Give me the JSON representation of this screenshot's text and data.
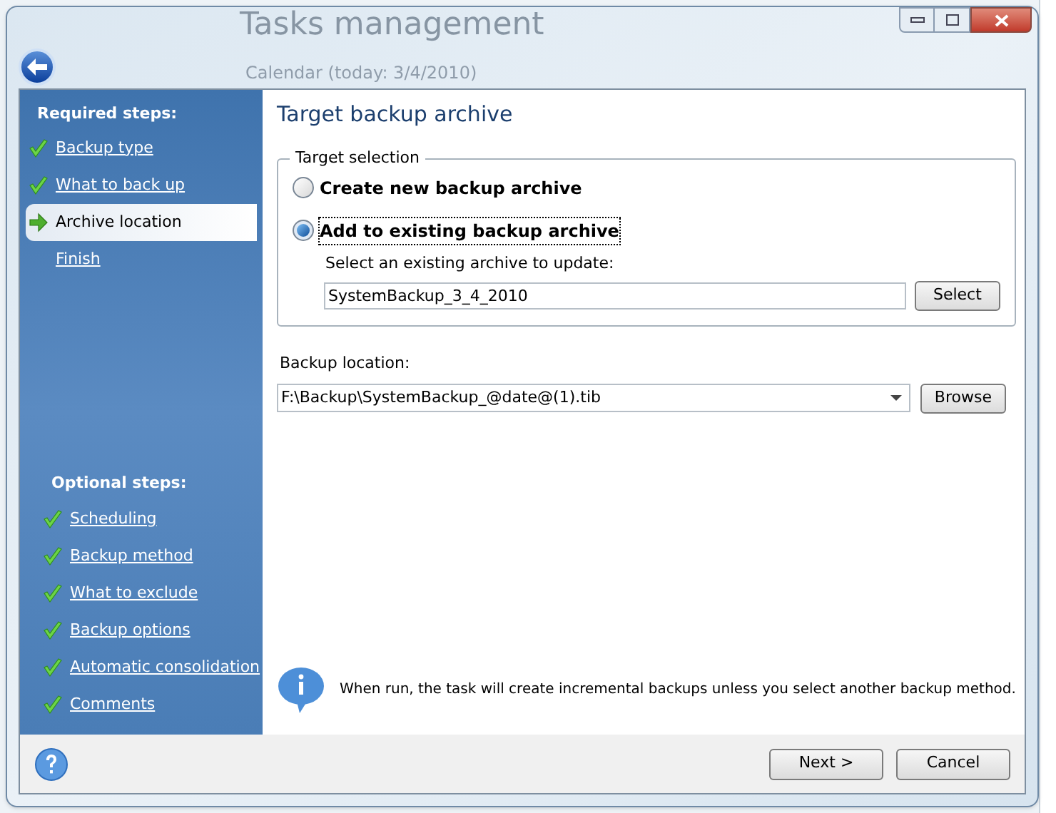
{
  "background_window": {
    "title": "Tasks management",
    "subtitle": "Calendar (today: 3/4/2010)"
  },
  "sidebar": {
    "required_heading": "Required steps:",
    "required_steps": [
      {
        "label": "Backup type",
        "completed": true,
        "selected": false
      },
      {
        "label": "What to back up",
        "completed": true,
        "selected": false
      },
      {
        "label": "Archive location",
        "completed": false,
        "selected": true
      },
      {
        "label": "Finish",
        "completed": false,
        "selected": false
      }
    ],
    "optional_heading": "Optional steps:",
    "optional_steps": [
      {
        "label": "Scheduling",
        "completed": true,
        "selected": false
      },
      {
        "label": "Backup method",
        "completed": true,
        "selected": false
      },
      {
        "label": "What to exclude",
        "completed": true,
        "selected": false
      },
      {
        "label": "Backup options",
        "completed": true,
        "selected": false
      },
      {
        "label": "Automatic consolidation",
        "completed": true,
        "selected": false
      },
      {
        "label": "Comments",
        "completed": true,
        "selected": false
      }
    ]
  },
  "page_title": "Target backup archive",
  "target_selection": {
    "legend": "Target selection",
    "options": [
      {
        "label": "Create new backup archive",
        "selected": false
      },
      {
        "label": "Add to existing backup archive",
        "selected": true
      }
    ],
    "archive_label": "Select an existing archive to update:",
    "archive_value": "SystemBackup_3_4_2010",
    "select_button": "Select"
  },
  "location": {
    "label": "Backup location:",
    "value": "F:\\Backup\\SystemBackup_@date@(1).tib",
    "browse_button": "Browse"
  },
  "info_text": "When run, the task will create incremental backups unless you select another backup method.",
  "buttons": [
    "Next >",
    "Cancel"
  ]
}
